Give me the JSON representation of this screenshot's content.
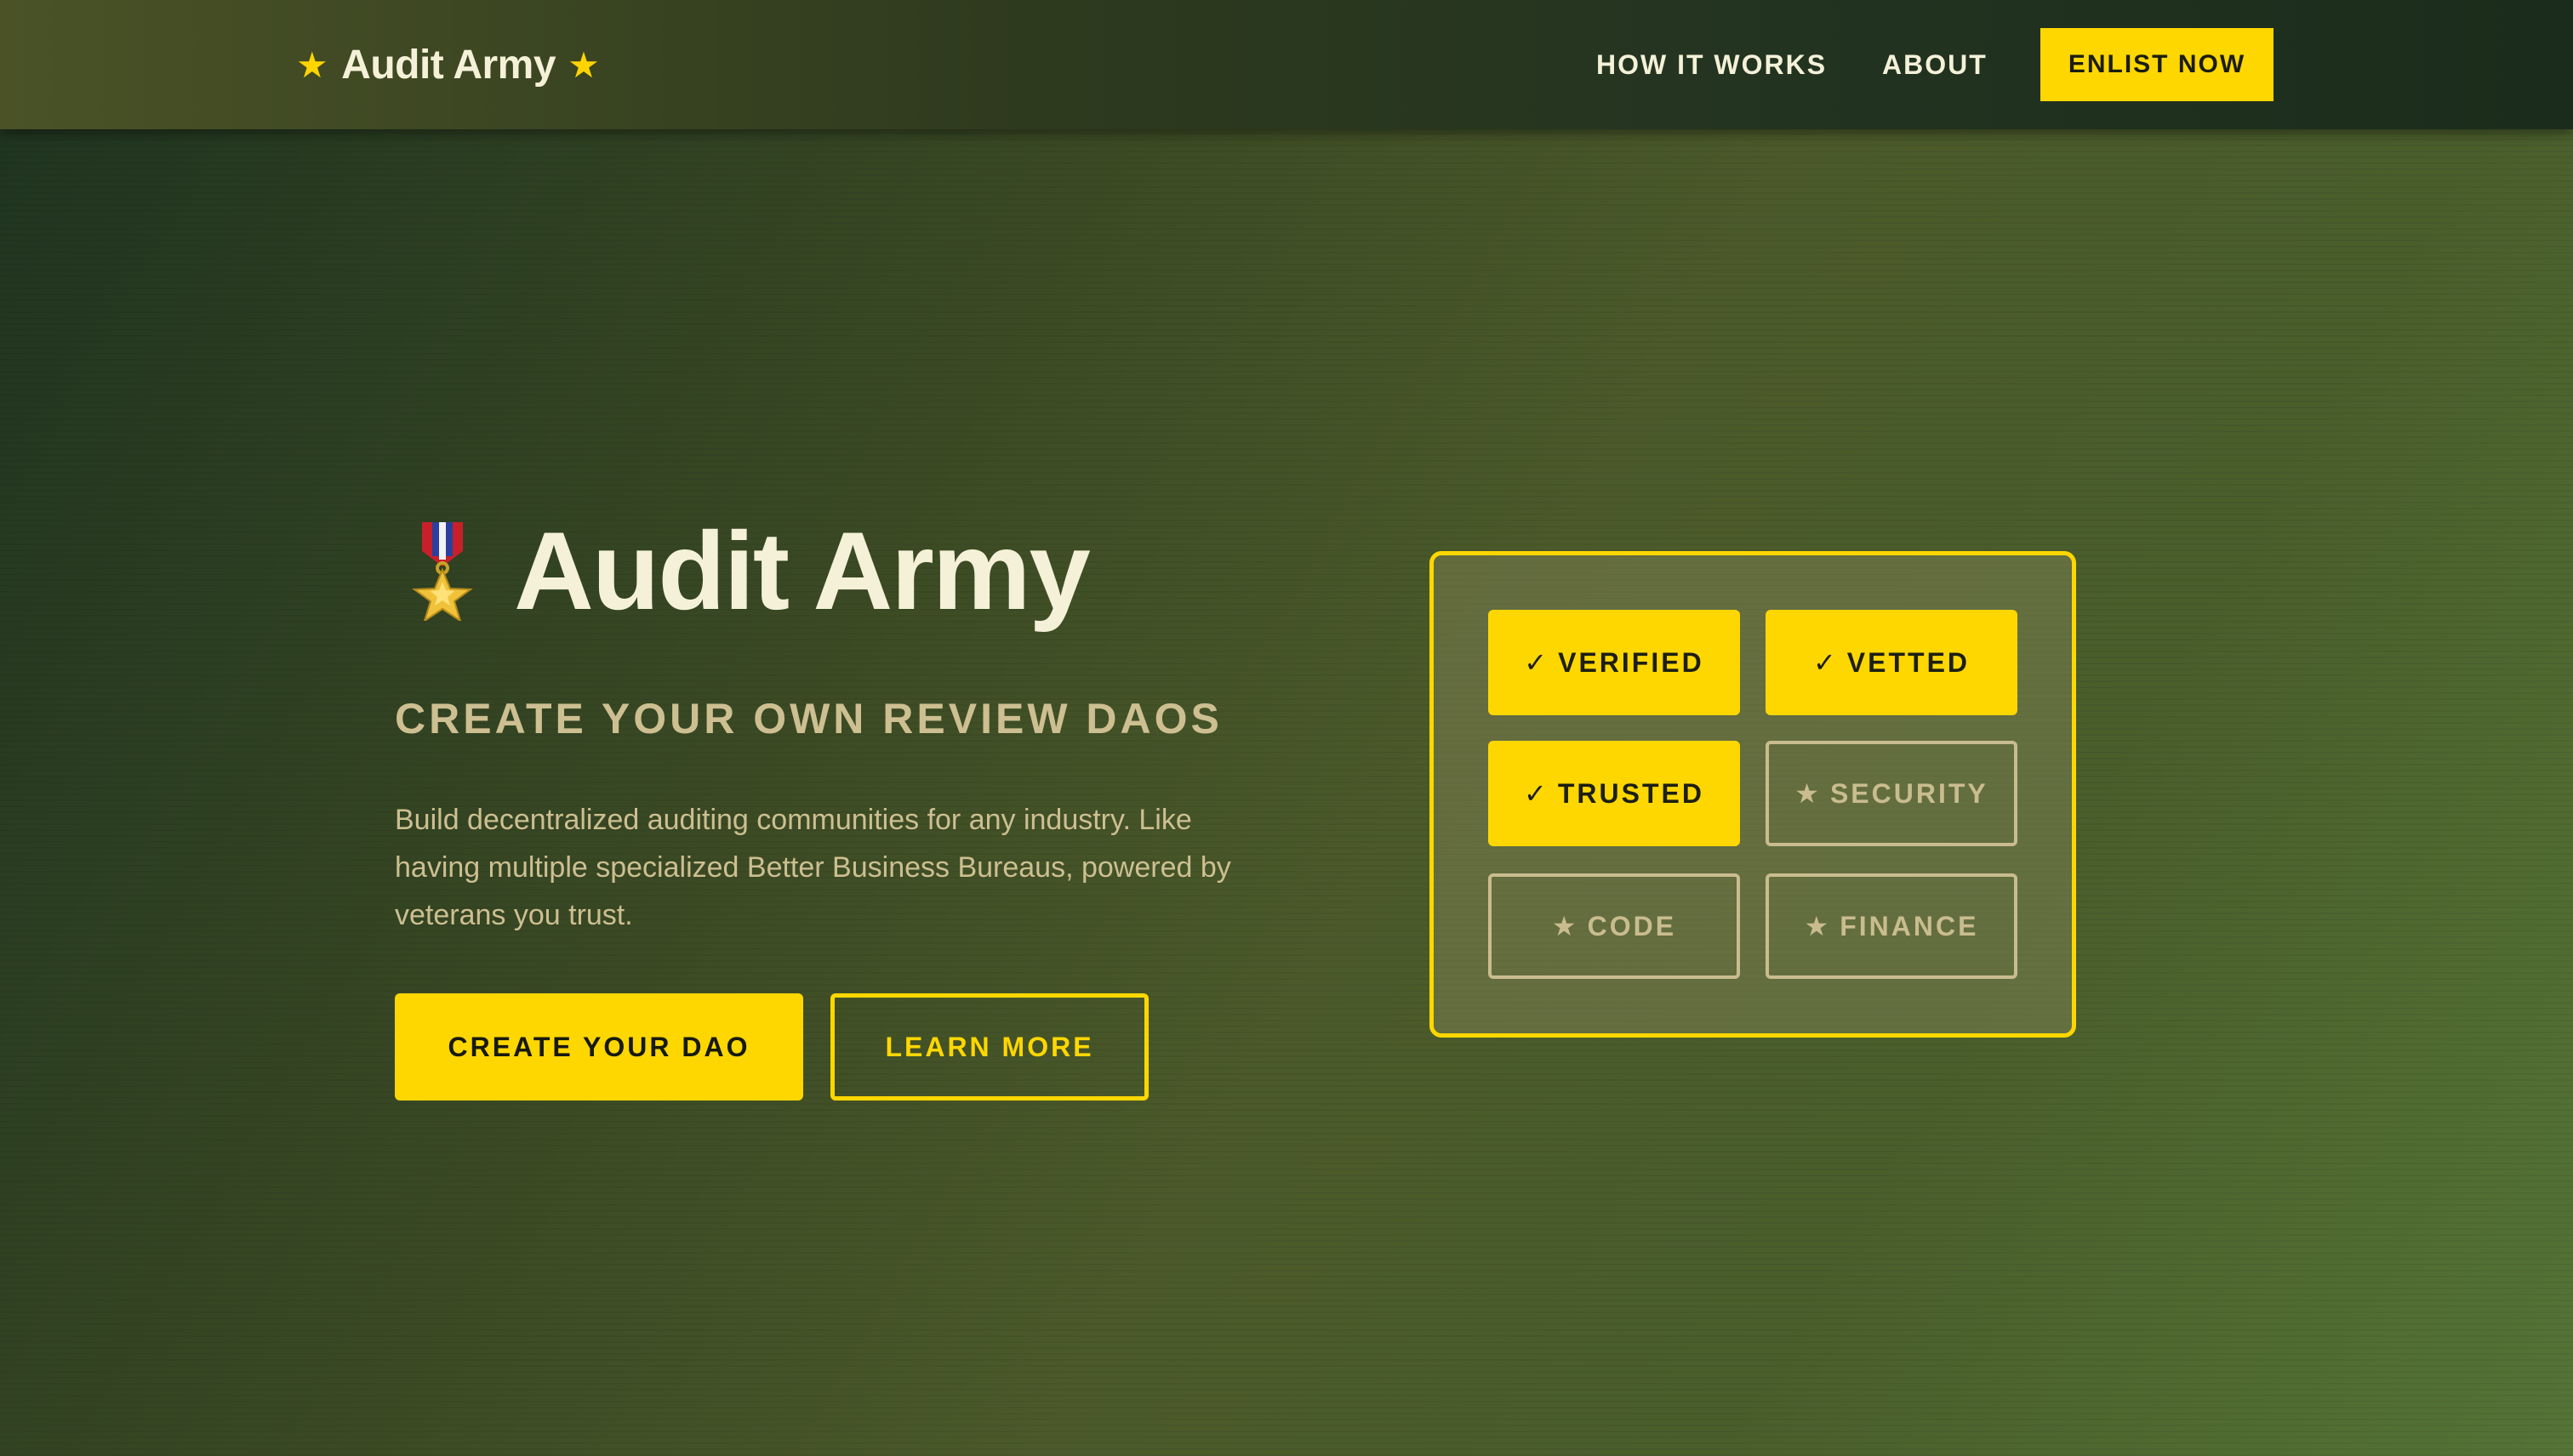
{
  "nav": {
    "logo_text": "Audit Army",
    "logo_star": "★",
    "links": [
      "HOW IT WORKS",
      "ABOUT"
    ],
    "cta": "ENLIST NOW"
  },
  "hero": {
    "icon": "military-medal-icon",
    "title": "Audit Army",
    "tagline": "CREATE YOUR OWN REVIEW DAOS",
    "description": "Build decentralized auditing communities for any industry. Like having multiple specialized Better Business Bureaus, powered by veterans you trust.",
    "primary_button": "CREATE YOUR DAO",
    "secondary_button": "LEARN MORE"
  },
  "badges": [
    {
      "mark": "✓",
      "label": "VERIFIED",
      "active": true
    },
    {
      "mark": "✓",
      "label": "VETTED",
      "active": true
    },
    {
      "mark": "✓",
      "label": "TRUSTED",
      "active": true
    },
    {
      "mark": "★",
      "label": "SECURITY",
      "active": false
    },
    {
      "mark": "★",
      "label": "CODE",
      "active": false
    },
    {
      "mark": "★",
      "label": "FINANCE",
      "active": false
    }
  ],
  "colors": {
    "accent": "#ffd700",
    "text_light": "#f4f1d8",
    "text_muted": "#cdbf91",
    "nav_bg": "#2e3a1e"
  }
}
